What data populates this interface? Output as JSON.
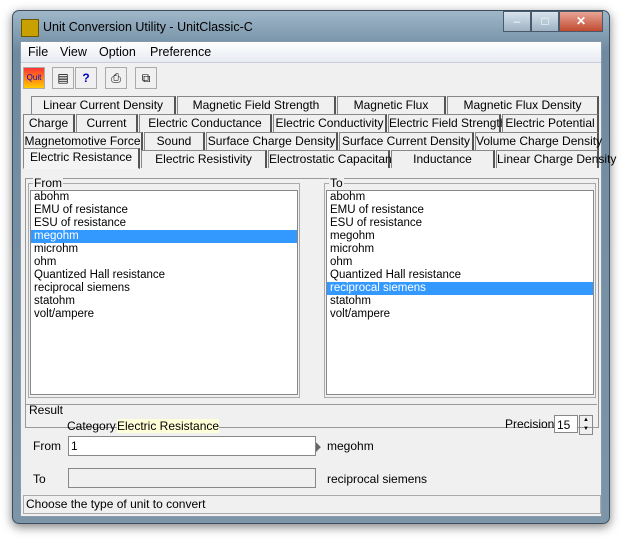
{
  "window": {
    "title": "Unit Conversion Utility - UnitClassic-C"
  },
  "menu": [
    "File",
    "View",
    "Option",
    "Preference"
  ],
  "toolbar": {
    "quit_label": "Quit",
    "help_label": "?"
  },
  "tabs": [
    [
      "Linear Current Density",
      "Magnetic Field Strength",
      "Magnetic Flux",
      "Magnetic Flux Density"
    ],
    [
      "Charge",
      "Current",
      "Electric Conductance",
      "Electric Conductivity",
      "Electric Field Strength",
      "Electric Potential"
    ],
    [
      "Magnetomotive Force",
      "Sound",
      "Surface Charge Density",
      "Surface Current Density",
      "Volume Charge Density"
    ],
    [
      "Electric Resistance",
      "Electric Resistivity",
      "Electrostatic Capacitance",
      "Inductance",
      "Linear Charge Density"
    ]
  ],
  "selected_tab": "Electric Resistance",
  "from": {
    "label": "From",
    "items": [
      "abohm",
      "EMU of resistance",
      "ESU of resistance",
      "megohm",
      "microhm",
      "ohm",
      "Quantized Hall resistance",
      "reciprocal siemens",
      "statohm",
      "volt/ampere"
    ],
    "selected": "megohm"
  },
  "to": {
    "label": "To",
    "items": [
      "abohm",
      "EMU of resistance",
      "ESU of resistance",
      "megohm",
      "microhm",
      "ohm",
      "Quantized Hall resistance",
      "reciprocal siemens",
      "statohm",
      "volt/ampere"
    ],
    "selected": "reciprocal siemens"
  },
  "result": {
    "label": "Result",
    "category_label": "Category:",
    "category": "Electric Resistance",
    "precision_label": "Precision",
    "precision": "15",
    "from_label": "From",
    "from_value": "1",
    "from_unit": "megohm",
    "to_label": "To",
    "to_value": "",
    "to_unit": "reciprocal siemens"
  },
  "status": "Choose the type of unit to convert"
}
